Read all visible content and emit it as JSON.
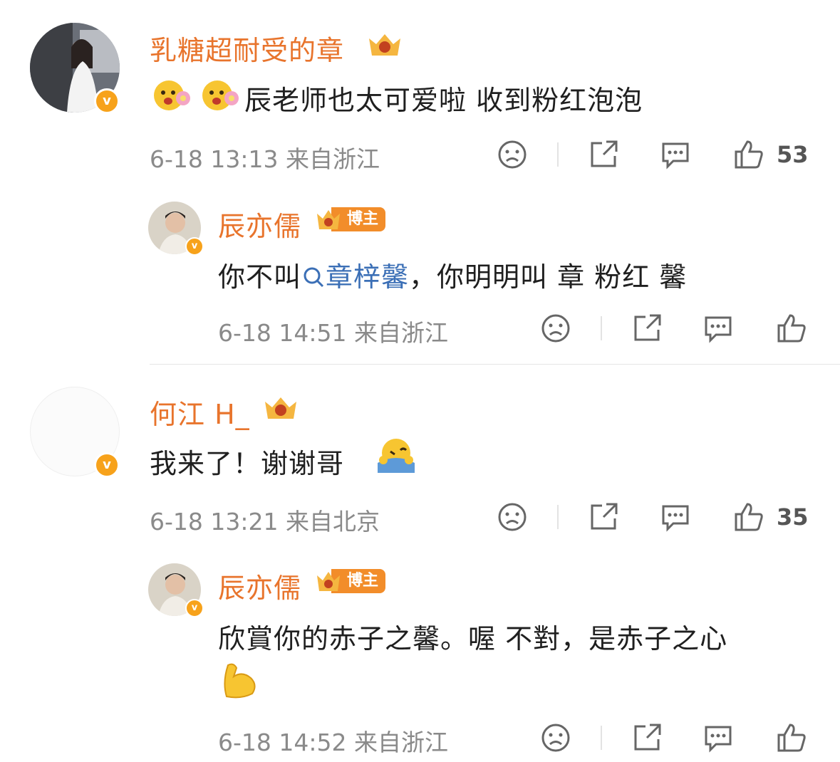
{
  "comments": [
    {
      "author": "乳糖超耐受的章",
      "text_before": "",
      "text": "辰老师也太可爱啦 收到粉红泡泡",
      "meta": "6-18 13:13 来自浙江",
      "likes": "53",
      "reply": {
        "author": "辰亦儒",
        "badge": "博主",
        "text_prefix": "你不叫",
        "link": "章梓馨",
        "text_suffix": "，你明明叫 章 粉红 馨",
        "meta": "6-18 14:51 来自浙江"
      }
    },
    {
      "author": "何江 H_",
      "text": "我来了！谢谢哥",
      "meta": "6-18 13:21 来自北京",
      "likes": "35",
      "reply": {
        "author": "辰亦儒",
        "badge": "博主",
        "text_line1": "欣賞你的赤子之馨。喔 不對，是赤子之心",
        "meta": "6-18 14:52 来自浙江"
      }
    }
  ],
  "colors": {
    "name": "#e8742c",
    "verified": "#f7a21b",
    "link": "#3b6fb6",
    "meta": "#8a8a8a"
  }
}
